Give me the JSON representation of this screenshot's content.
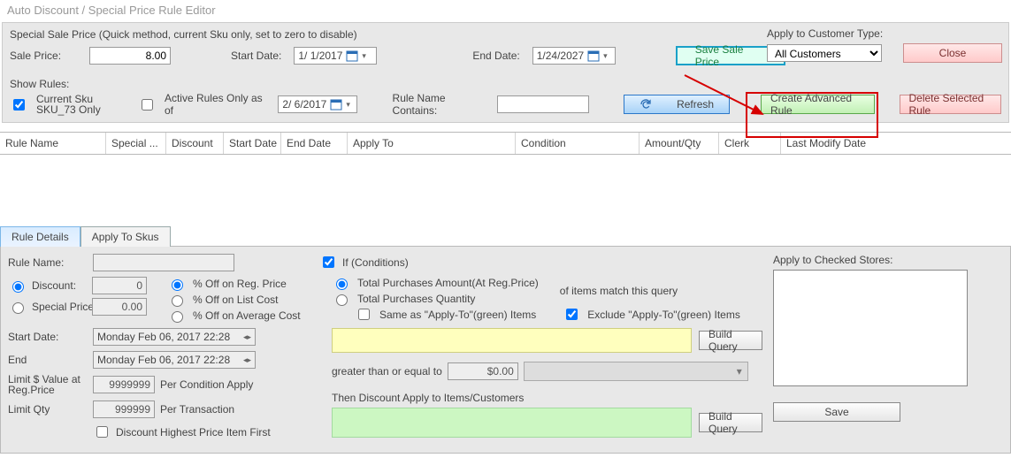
{
  "title": "Auto Discount / Special Price Rule Editor",
  "sale": {
    "header": "Special Sale Price (Quick method, current Sku only, set to zero to disable)",
    "sale_price_label": "Sale Price:",
    "sale_price_value": "8.00",
    "start_date_label": "Start Date:",
    "start_date_value": "1/  1/2017",
    "end_date_label": "End Date:",
    "end_date_value": "1/24/2027",
    "save_button": "Save Sale Price"
  },
  "customer_type": {
    "label": "Apply to Customer Type:",
    "selected": "All Customers"
  },
  "close_button": "Close",
  "show_rules": {
    "label": "Show Rules:",
    "current_sku_label": "Current Sku SKU_73 Only",
    "active_only_label": "Active Rules Only as of",
    "active_only_date": "2/  6/2017",
    "rule_name_contains_label": "Rule Name Contains:",
    "refresh": "Refresh",
    "create_rule": "Create Advanced Rule",
    "delete_rule": "Delete Selected Rule"
  },
  "columns": {
    "c0": "Rule Name",
    "c1": "Special ...",
    "c2": "Discount",
    "c3": "Start Date",
    "c4": "End Date",
    "c5": "Apply To",
    "c6": "Condition",
    "c7": "Amount/Qty",
    "c8": "Clerk",
    "c9": "Last Modify Date"
  },
  "tabs": {
    "details": "Rule Details",
    "skus": "Apply To Skus"
  },
  "details": {
    "rule_name_label": "Rule Name:",
    "discount_label": "Discount:",
    "discount_value": "0",
    "special_price_label": "Special Price:",
    "special_price_value": "0.00",
    "pct_reg": "% Off on Reg. Price",
    "pct_list": "% Off on List Cost",
    "pct_avg": "% Off on Average Cost",
    "start_date_label": "Start Date:",
    "start_date_value": "Monday    Feb 06, 2017 22:28",
    "end_label": "End",
    "end_value": "Monday    Feb 06, 2017 22:28",
    "limit_dollar_label": "Limit $ Value at Reg.Price",
    "limit_dollar_value": "9999999",
    "per_condition": "Per Condition Apply",
    "limit_qty_label": "Limit Qty",
    "limit_qty_value": "999999",
    "per_transaction": "Per Transaction",
    "discount_highest": "Discount Highest Price Item First"
  },
  "conditions": {
    "if_label": "If (Conditions)",
    "total_purchases_amount": "Total Purchases Amount(At Reg.Price)",
    "total_purchases_qty": "Total Purchases Quantity",
    "of_items": "of items match this query",
    "same_as": "Same  as \"Apply-To\"(green) Items",
    "exclude": "Exclude \"Apply-To\"(green) Items",
    "build_query": "Build Query",
    "greater_than": "greater than or equal to",
    "gte_value": "$0.00",
    "then_label": "Then Discount Apply to Items/Customers"
  },
  "stores": {
    "label": "Apply to Checked Stores:",
    "save": "Save"
  }
}
